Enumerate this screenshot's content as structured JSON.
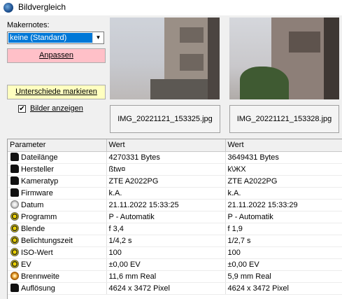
{
  "window": {
    "title": "Bildvergleich"
  },
  "controls": {
    "makernotes_label": "Makernotes:",
    "makernotes_value": "keine (Standard)",
    "anpassen_label": "Anpassen",
    "unterschiede_label": "Unterschiede markieren",
    "bilder_label": "Bilder anzeigen",
    "bilder_checked": "✔"
  },
  "images": [
    {
      "filename": "IMG_20221121_153325.jpg"
    },
    {
      "filename": "IMG_20221121_153328.jpg"
    }
  ],
  "table": {
    "columns": [
      "Parameter",
      "Wert",
      "Wert"
    ],
    "rows": [
      {
        "icon": "camera-icon",
        "param": "Dateilänge",
        "v1": "4270331 Bytes",
        "v2": "3649431 Bytes"
      },
      {
        "icon": "camera-icon",
        "param": "Hersteller",
        "v1": "ßtw¤",
        "v2": "k\\ЖX"
      },
      {
        "icon": "camera-icon",
        "param": "Kameratyp",
        "v1": "ZTE A2022PG",
        "v2": "ZTE A2022PG"
      },
      {
        "icon": "camera-icon",
        "param": "Firmware",
        "v1": "k.A.",
        "v2": "k.A."
      },
      {
        "icon": "clock-icon",
        "param": "Datum",
        "v1": "21.11.2022 15:33:25",
        "v2": "21.11.2022 15:33:29"
      },
      {
        "icon": "gear-icon",
        "param": "Programm",
        "v1": "P - Automatik",
        "v2": "P - Automatik"
      },
      {
        "icon": "gear-icon",
        "param": "Blende",
        "v1": "f 3,4",
        "v2": "f 1,9"
      },
      {
        "icon": "gear-icon",
        "param": "Belichtungszeit",
        "v1": "1/4,2 s",
        "v2": "1/2,7 s"
      },
      {
        "icon": "gear-icon",
        "param": "ISO-Wert",
        "v1": "100",
        "v2": "100"
      },
      {
        "icon": "gear-icon",
        "param": "EV",
        "v1": "±0,00 EV",
        "v2": "±0,00 EV"
      },
      {
        "icon": "lens-icon",
        "param": "Brennweite",
        "v1": "11,6 mm Real",
        "v2": "5,9 mm Real"
      },
      {
        "icon": "camera-icon",
        "param": "Auflösung",
        "v1": "4624 x 3472 Pixel",
        "v2": "4624 x 3472 Pixel"
      }
    ]
  }
}
